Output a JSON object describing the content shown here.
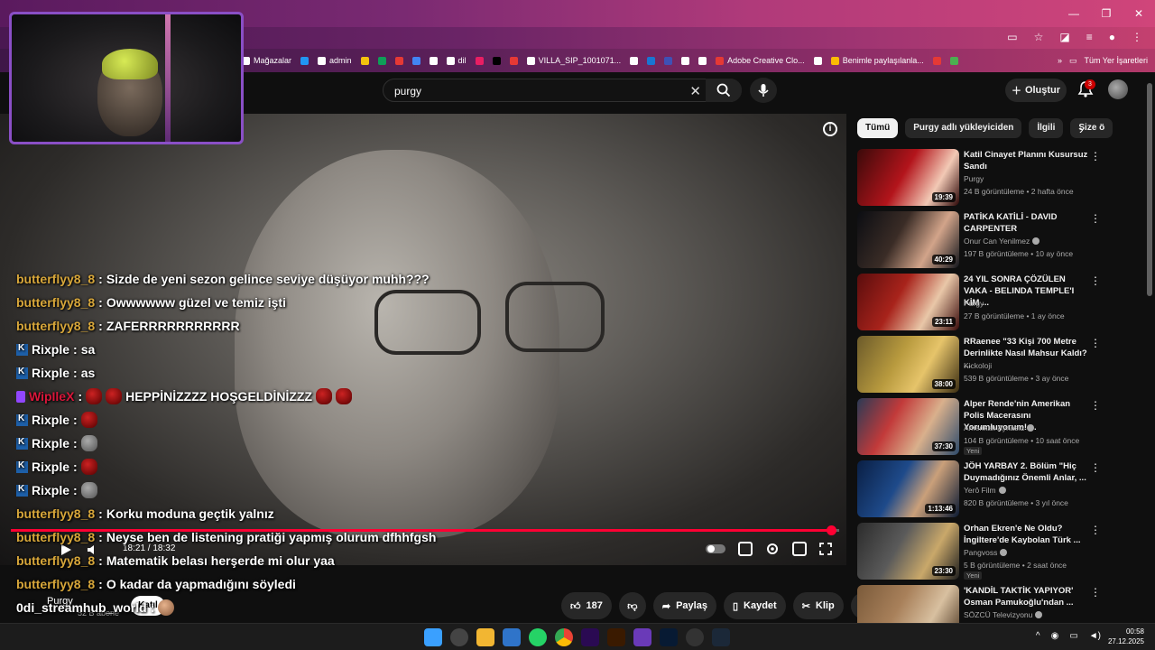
{
  "browser": {
    "bookmarks": [
      {
        "label": "Mağazalar",
        "color": "#ffffff"
      },
      {
        "label": "",
        "color": "#2196f3"
      },
      {
        "label": "admin",
        "color": "#ffffff"
      },
      {
        "label": "",
        "color": "#f4c20d"
      },
      {
        "label": "",
        "color": "#0f9d58"
      },
      {
        "label": "",
        "color": "#e53935"
      },
      {
        "label": "",
        "color": "#4285f4"
      },
      {
        "label": "",
        "color": "#ffffff"
      },
      {
        "label": "dil",
        "color": "#ffffff"
      },
      {
        "label": "",
        "color": "#e91e63"
      },
      {
        "label": "",
        "color": "#000000"
      },
      {
        "label": "",
        "color": "#e53935"
      },
      {
        "label": "VILLA_SIP_1001071...",
        "color": "#ffffff"
      },
      {
        "label": "",
        "color": "#ffffff"
      },
      {
        "label": "",
        "color": "#1976d2"
      },
      {
        "label": "",
        "color": "#3f51b5"
      },
      {
        "label": "",
        "color": "#ffffff"
      },
      {
        "label": "",
        "color": "#ffffff"
      },
      {
        "label": "Adobe Creative Clo...",
        "color": "#e53935"
      },
      {
        "label": "",
        "color": "#ffffff"
      },
      {
        "label": "Benimle paylaşılanla...",
        "color": "#fbbc04"
      },
      {
        "label": "",
        "color": "#e53935"
      },
      {
        "label": "",
        "color": "#4caf50"
      }
    ],
    "all_bookmarks": "Tüm Yer İşaretleri",
    "more": "»"
  },
  "youtube": {
    "search_query": "purgy",
    "create_label": "Oluştur",
    "notification_count": "3",
    "chips": [
      "Tümü",
      "Purgy adlı yükleyiciden",
      "İlgili",
      "Size ö"
    ],
    "time": "18:21 / 18:32",
    "progress": 0.99,
    "channel": {
      "name": "Purgy",
      "subs": "52 B abone",
      "join": "Katıl"
    },
    "actions": {
      "likes": "187",
      "share": "Paylaş",
      "save": "Kaydet",
      "clip": "Klip",
      "more": "⋯"
    },
    "recommendations": [
      {
        "title": "Katil Cinayet Planını Kusursuz Sandı",
        "channel": "Purgy",
        "verified": false,
        "meta": "24 B görüntüleme • 2 hafta önce",
        "duration": "19:39",
        "badge": "",
        "thumb": "linear-gradient(120deg,#3a0a0a 0%,#b3141b 45%,#f2c9b5 75%,#2b0505 100%)"
      },
      {
        "title": "PATİKA KATİLİ - DAVID CARPENTER",
        "channel": "Onur Can Yenilmez",
        "verified": true,
        "meta": "197 B görüntüleme • 10 ay önce",
        "duration": "40:29",
        "badge": "",
        "thumb": "linear-gradient(120deg,#0b0d12 0%,#3a2c26 40%,#d2a48a 70%,#13161c 100%)"
      },
      {
        "title": "24 YIL SONRA ÇÖZÜLEN VAKA - BELINDA TEMPLE'I KİM ...",
        "channel": "Purgy",
        "verified": false,
        "meta": "27 B görüntüleme • 1 ay önce",
        "duration": "23:11",
        "badge": "",
        "thumb": "linear-gradient(120deg,#5a0d0d 0%,#a8231b 40%,#e9c7a8 70%,#3a0b0b 100%)"
      },
      {
        "title": "RRaenee \"33 Kişi 700 Metre Derinlikte Nasıl Mahsur Kaldı? ...",
        "channel": "Kickoloji",
        "verified": false,
        "meta": "539 B görüntüleme • 3 ay önce",
        "duration": "38:00",
        "badge": "",
        "thumb": "linear-gradient(120deg,#6b5a2a 0%,#b89a3e 40%,#e6c46a 65%,#3c2e12 100%)"
      },
      {
        "title": "Alper Rende'nin Amerikan Polis Macerasını Yorumluyorum! ...",
        "channel": "Amerikalı Aynasız",
        "verified": true,
        "meta": "104 B görüntüleme • 10 saat önce",
        "duration": "37:30",
        "badge": "Yeni",
        "thumb": "linear-gradient(120deg,#2a3a55 0%,#c23a3a 35%,#d9b08c 65%,#2d4a6b 100%)"
      },
      {
        "title": "JÖH YARBAY 2. Bölüm \"Hiç Duymadığınız Önemli Anlar, ...",
        "channel": "Yerô Film",
        "verified": true,
        "meta": "820 B görüntüleme • 3 yıl önce",
        "duration": "1:13:46",
        "badge": "",
        "thumb": "linear-gradient(120deg,#0a1f44 0%,#1e4a8a 40%,#caa07a 65%,#0b1a33 100%)"
      },
      {
        "title": "Orhan Ekren'e Ne Oldu? İngiltere'de Kaybolan Türk ...",
        "channel": "Pangvoss",
        "verified": true,
        "meta": "5 B görüntüleme • 2 saat önce",
        "duration": "23:30",
        "badge": "Yeni",
        "thumb": "linear-gradient(120deg,#2b2b2b 0%,#5a5a5a 40%,#c9a86a 70%,#1e1e1e 100%)"
      },
      {
        "title": "'KANDİL TAKTİK YAPIYOR' Osman Pamukoğlu'ndan ...",
        "channel": "SÖZCÜ Televizyonu",
        "verified": true,
        "meta": "",
        "duration": "",
        "badge": "",
        "thumb": "linear-gradient(120deg,#7a5a3a 0%,#a8805a 40%,#d8c0a0 70%,#4a3420 100%)"
      }
    ]
  },
  "chat": [
    {
      "user": "butterflyy8_8",
      "platform": "twitch",
      "msg": "Sizde de yeni sezon gelince seviye düşüyor muhh???",
      "emotes": 0
    },
    {
      "user": "butterflyy8_8",
      "platform": "twitch",
      "msg": "Owwwwww güzel ve temiz işti",
      "emotes": 0
    },
    {
      "user": "butterflyy8_8",
      "platform": "twitch",
      "msg": "ZAFERRRRRRRRRRR",
      "emotes": 0
    },
    {
      "user": "Rixple",
      "platform": "kick",
      "msg": "sa",
      "emotes": 0
    },
    {
      "user": "Rixple",
      "platform": "kick",
      "msg": "as",
      "emotes": 0
    },
    {
      "user": "WipIleX",
      "platform": "twitch",
      "msg": "HEPPİNİZZZZ HOŞGELDİNİZZZ",
      "emotes": 2
    },
    {
      "user": "Rixple",
      "platform": "kick",
      "msg": "",
      "emotes": 1
    },
    {
      "user": "Rixple",
      "platform": "kick",
      "msg": "",
      "emotes": 1
    },
    {
      "user": "Rixple",
      "platform": "kick",
      "msg": "",
      "emotes": 1
    },
    {
      "user": "Rixple",
      "platform": "kick",
      "msg": "",
      "emotes": 1
    },
    {
      "user": "butterflyy8_8",
      "platform": "twitch",
      "msg": "Korku moduna geçtik yalnız",
      "emotes": 0
    },
    {
      "user": "butterflyy8_8",
      "platform": "twitch",
      "msg": "Neyse ben de listening pratiği yapmış olurum dfhhfgsh",
      "emotes": 0
    },
    {
      "user": "butterflyy8_8",
      "platform": "twitch",
      "msg": "Matematik belası herşerde mi olur yaa",
      "emotes": 0
    },
    {
      "user": "butterflyy8_8",
      "platform": "twitch",
      "msg": "O kadar da yapmadığını söyledi",
      "emotes": 0
    },
    {
      "user": "0di_streamhub_world",
      "platform": "none",
      "msg": "",
      "emotes": 1
    }
  ],
  "taskbar": {
    "time": "00:58",
    "date": "27.12.2025"
  }
}
